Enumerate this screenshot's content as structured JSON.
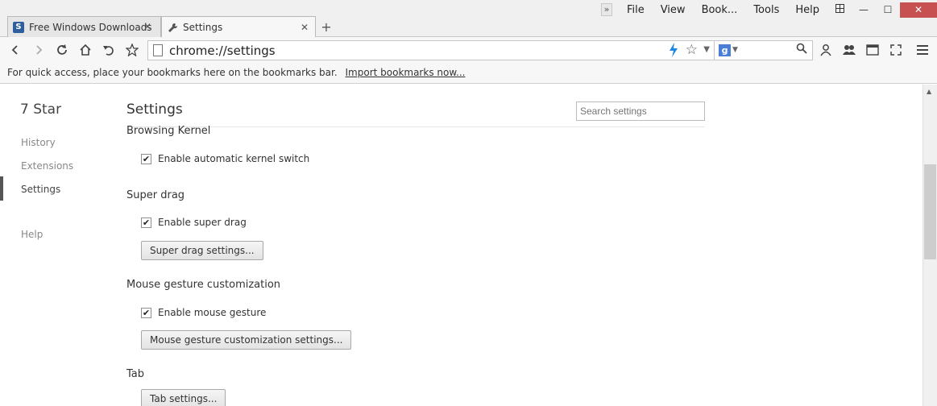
{
  "tabs": [
    {
      "label": "Free Windows Downloads",
      "icon": "softpedia-icon"
    },
    {
      "label": "Settings",
      "icon": "wrench-icon"
    }
  ],
  "menu": [
    "File",
    "View",
    "Book...",
    "Tools",
    "Help"
  ],
  "omnibox": {
    "url": "chrome://settings"
  },
  "bookmarks_bar": {
    "message": "For quick access, place your bookmarks here on the bookmarks bar.",
    "import_link": "Import bookmarks now..."
  },
  "nav": {
    "title": "7 Star",
    "items": [
      "History",
      "Extensions",
      "Settings",
      "Help"
    ]
  },
  "main": {
    "title": "Settings",
    "search_placeholder": "Search settings",
    "sections": [
      {
        "title": "Browsing Kernel",
        "checkbox": "Enable automatic kernel switch",
        "checked": true
      },
      {
        "title": "Super drag",
        "checkbox": "Enable super drag",
        "checked": true,
        "button": "Super drag settings..."
      },
      {
        "title": "Mouse gesture customization",
        "checkbox": "Enable mouse gesture",
        "checked": true,
        "button": "Mouse gesture customization settings..."
      },
      {
        "title": "Tab",
        "button": "Tab settings..."
      }
    ]
  },
  "colors": {
    "close_button": "#c75050",
    "lightning": "#1e88e5"
  }
}
